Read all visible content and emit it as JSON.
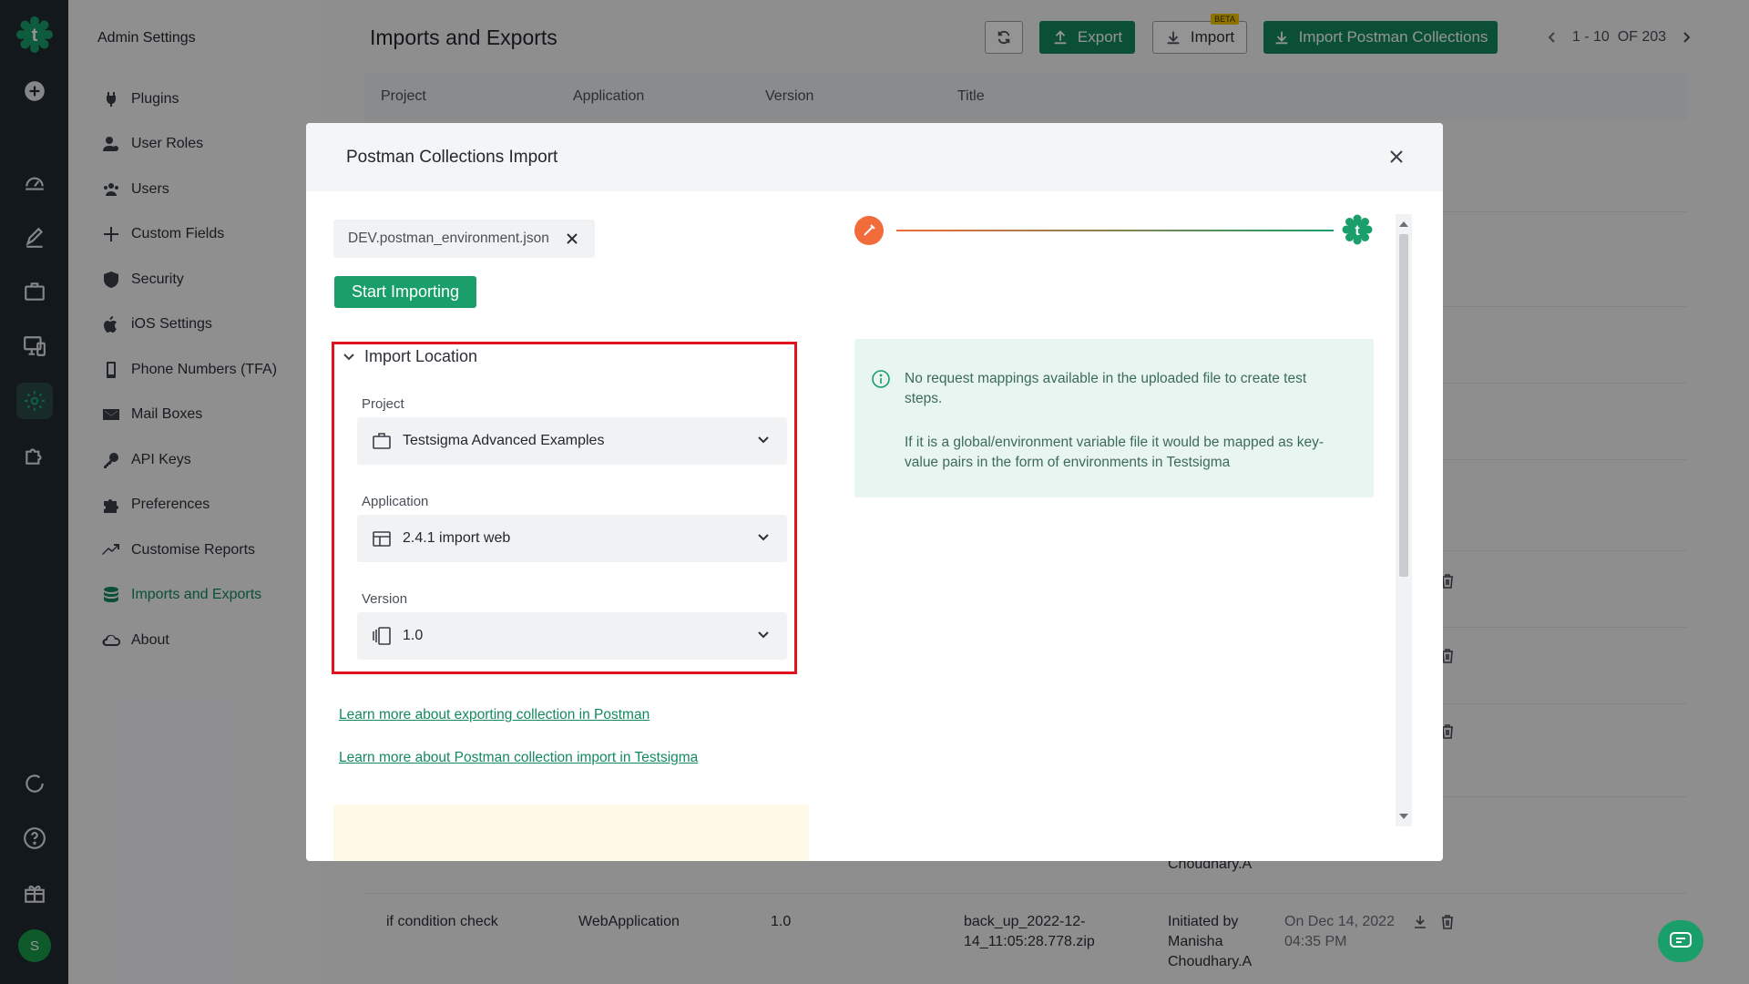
{
  "sidebar": {
    "title": "Admin Settings",
    "items": [
      {
        "label": "Plugins",
        "icon": "plug-icon"
      },
      {
        "label": "User Roles",
        "icon": "user-roles-icon"
      },
      {
        "label": "Users",
        "icon": "users-icon"
      },
      {
        "label": "Custom Fields",
        "icon": "plus-icon"
      },
      {
        "label": "Security",
        "icon": "shield-icon"
      },
      {
        "label": "iOS Settings",
        "icon": "apple-icon"
      },
      {
        "label": "Phone Numbers (TFA)",
        "icon": "phone-icon"
      },
      {
        "label": "Mail Boxes",
        "icon": "mail-icon"
      },
      {
        "label": "API Keys",
        "icon": "key-icon"
      },
      {
        "label": "Preferences",
        "icon": "puzzle-icon"
      },
      {
        "label": "Customise Reports",
        "icon": "trend-icon"
      },
      {
        "label": "Imports and Exports",
        "icon": "database-icon",
        "active": true
      },
      {
        "label": "About",
        "icon": "cloud-icon"
      }
    ]
  },
  "header": {
    "title": "Imports and Exports",
    "export_label": "Export",
    "import_label": "Import",
    "beta_badge": "BETA",
    "import_postman_label": "Import Postman Collections",
    "pager_text": "1 - 10  OF 203"
  },
  "table": {
    "columns": [
      "Project",
      "Application",
      "Version",
      "Title"
    ],
    "visible_row": {
      "project": "if condition check",
      "application": "WebApplication",
      "version": "1.0",
      "title": "back_up_2022-12-14_11:05:28.778.zip",
      "initiated": "Initiated by Manisha Choudhary.A",
      "date": "On Dec 14, 2022 04:35 PM"
    },
    "partial_text": "Choudhary.A"
  },
  "modal": {
    "title": "Postman Collections Import",
    "file_chip": "DEV.postman_environment.json",
    "start_button": "Start Importing",
    "section_title": "Import Location",
    "project_label": "Project",
    "project_value": "Testsigma Advanced Examples",
    "application_label": "Application",
    "application_value": "2.4.1 import web",
    "version_label": "Version",
    "version_value": "1.0",
    "link1": "Learn more about exporting collection in Postman",
    "link2": "Learn more about Postman collection import in Testsigma",
    "info_line1": "No request mappings available in the uploaded file to create test steps.",
    "info_line2": "If it is a global/environment variable file it would be mapped as key-value pairs in the form of environments in Testsigma"
  },
  "user": {
    "avatar_letter": "S"
  },
  "colors": {
    "brand_green": "#138a5d",
    "postman_orange": "#f26b3a",
    "highlight_red": "#e0121c",
    "rail_bg": "#1f2a30"
  }
}
